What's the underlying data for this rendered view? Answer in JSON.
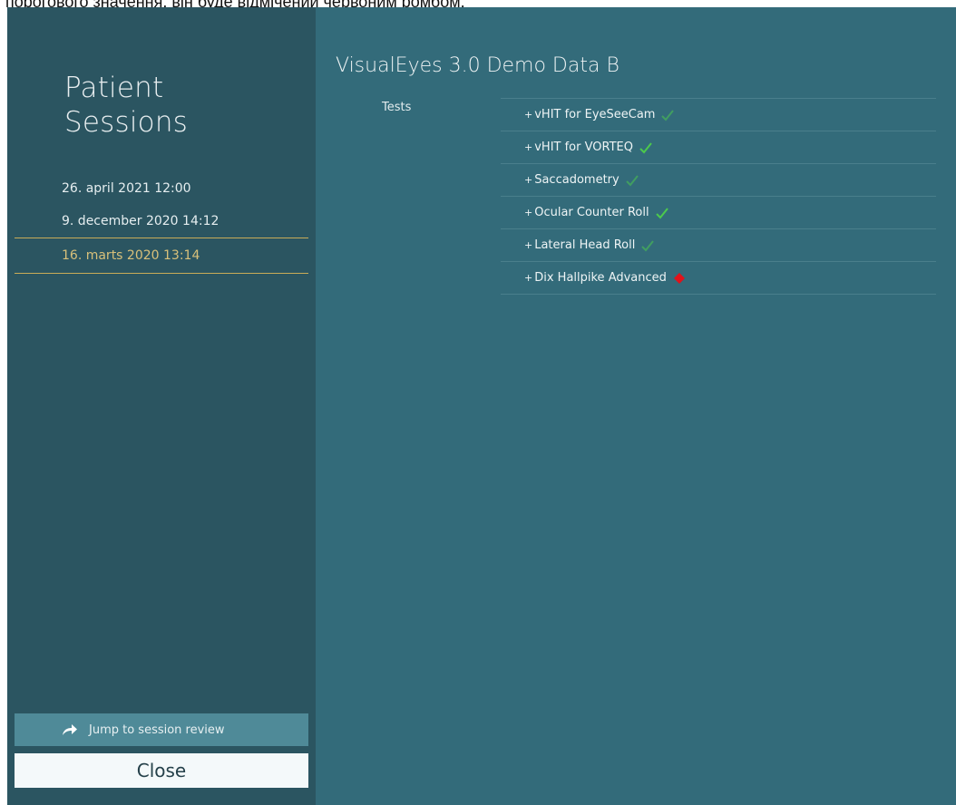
{
  "caption": "порогового значення, він буде відмічений червоним ромбом.",
  "sidebar": {
    "title_line1": "Patient",
    "title_line2": "Sessions",
    "sessions": [
      {
        "label": "26. april 2021 12:00"
      },
      {
        "label": "9. december 2020 14:12"
      },
      {
        "label": "16. marts 2020 13:14"
      }
    ],
    "selected_index": 2,
    "jump_label": "Jump to session review",
    "close_label": "Close"
  },
  "main": {
    "title": "VisualEyes 3.0 Demo Data B",
    "tests_label": "Tests",
    "tests": [
      {
        "prefix": "+",
        "name": "vHIT for EyeSeeCam",
        "status": "check-faded-icon"
      },
      {
        "prefix": "+",
        "name": "vHIT for VORTEQ",
        "status": "check-icon"
      },
      {
        "prefix": "+",
        "name": "Saccadometry",
        "status": "check-faded-icon"
      },
      {
        "prefix": "+",
        "name": "Ocular Counter Roll",
        "status": "check-icon"
      },
      {
        "prefix": "+",
        "name": "Lateral Head Roll",
        "status": "check-faded-icon"
      },
      {
        "prefix": "+",
        "name": "Dix Hallpike Advanced",
        "status": "red-diamond-icon"
      }
    ]
  },
  "colors": {
    "accent_selected": "#c9ac58",
    "check_green": "#4cc94c",
    "alert_red": "#e0131b"
  }
}
